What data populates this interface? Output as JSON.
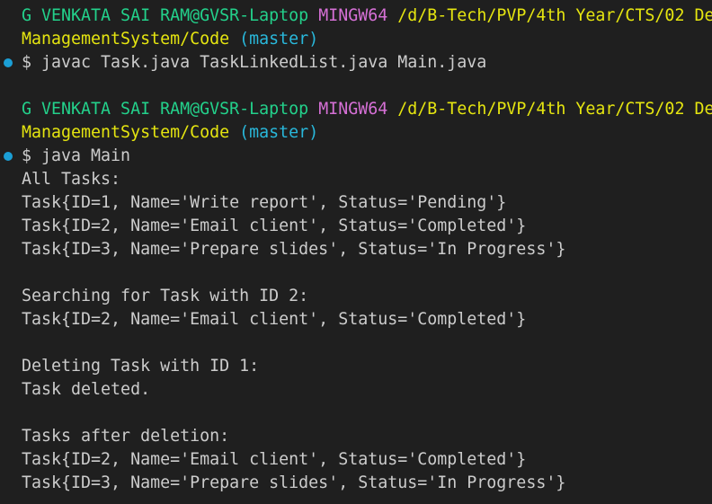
{
  "prompt1": {
    "user_host": "G VENKATA SAI RAM@GVSR-Laptop",
    "shell": "MINGW64",
    "path_part1": "/d/B-Tech/PVP/4th Year/CTS/02 De",
    "path_part2": "ManagementSystem/Code",
    "branch": "(master)"
  },
  "command1": "$ javac Task.java TaskLinkedList.java Main.java",
  "prompt2": {
    "user_host": "G VENKATA SAI RAM@GVSR-Laptop",
    "shell": "MINGW64",
    "path_part1": "/d/B-Tech/PVP/4th Year/CTS/02 De",
    "path_part2": "ManagementSystem/Code",
    "branch": "(master)"
  },
  "command2": "$ java Main",
  "output": [
    "All Tasks:",
    "Task{ID=1, Name='Write report', Status='Pending'}",
    "Task{ID=2, Name='Email client', Status='Completed'}",
    "Task{ID=3, Name='Prepare slides', Status='In Progress'}",
    "",
    "Searching for Task with ID 2:",
    "Task{ID=2, Name='Email client', Status='Completed'}",
    "",
    "Deleting Task with ID 1:",
    "Task deleted.",
    "",
    "Tasks after deletion:",
    "Task{ID=2, Name='Email client', Status='Completed'}",
    "Task{ID=3, Name='Prepare slides', Status='In Progress'}"
  ],
  "colors": {
    "background": "#1f1f1f",
    "user_host": "#23d18b",
    "shell": "#d670d6",
    "path": "#e5e510",
    "branch": "#29b8db",
    "text": "#cccccc",
    "decoration": "#1b9fd6"
  }
}
